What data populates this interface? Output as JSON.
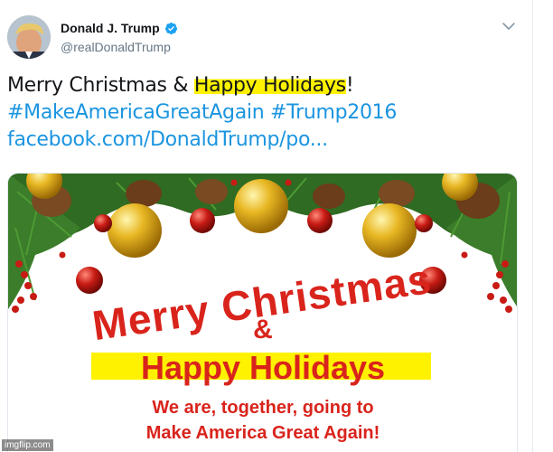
{
  "author": {
    "display_name": "Donald J. Trump",
    "handle": "@realDonaldTrump",
    "verified": true
  },
  "tweet": {
    "text_prefix": "Merry Christmas & ",
    "text_highlight": "Happy Holidays",
    "text_suffix": "!",
    "hashtags": [
      "#MakeAmericaGreatAgain",
      "#Trump2016"
    ],
    "link": "facebook.com/DonaldTrump/po..."
  },
  "card": {
    "line1": "Merry Christmas",
    "line2": "&",
    "line3": "Happy Holidays",
    "line4": "We are, together, going to",
    "line5": "Make America Great Again!"
  },
  "watermark": "imgflip.com",
  "icons": [
    "verified-badge-icon",
    "chevron-down-icon"
  ],
  "colors": {
    "link_blue": "#1b95e0",
    "card_red": "#d9241c",
    "highlight_yellow": "#fff200"
  }
}
